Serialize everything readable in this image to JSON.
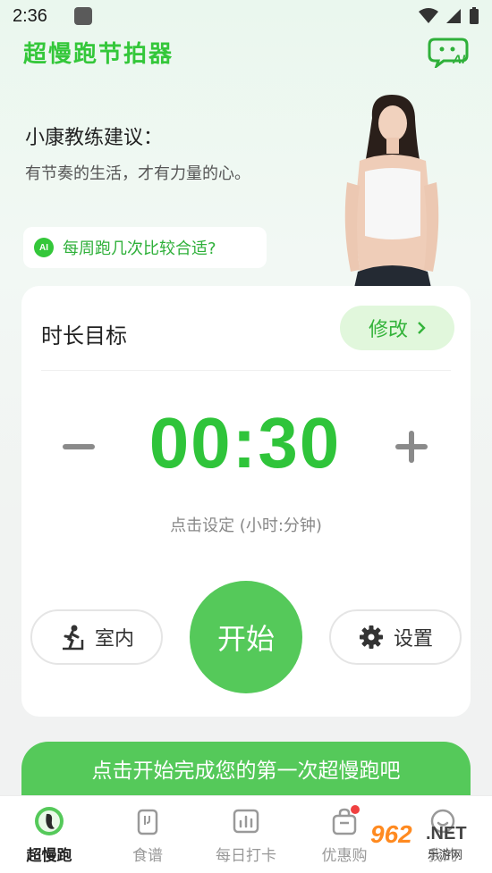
{
  "status_bar": {
    "time": "2:36"
  },
  "header": {
    "app_title": "超慢跑节拍器",
    "ai_button_label": "AI"
  },
  "coach": {
    "name": "小康教练建议：",
    "quote": "有节奏的生活，才有力量的心。",
    "suggestion_chip": "每周跑几次比较合适?",
    "chip_icon_label": "AI"
  },
  "timer_card": {
    "title": "时长目标",
    "edit_label": "修改",
    "time": "00:30",
    "hint": "点击设定 (小时:分钟)",
    "indoor_label": "室内",
    "start_label": "开始",
    "settings_label": "设置"
  },
  "cta": {
    "label": "点击开始完成您的第一次超慢跑吧"
  },
  "bottom_nav": {
    "items": [
      {
        "label": "超慢跑",
        "icon": "run-foot-icon",
        "active": true
      },
      {
        "label": "食谱",
        "icon": "recipe-icon",
        "active": false
      },
      {
        "label": "每日打卡",
        "icon": "chart-checkin-icon",
        "active": false
      },
      {
        "label": "优惠购",
        "icon": "shopping-bag-icon",
        "active": false,
        "badge": true
      },
      {
        "label": "我的",
        "icon": "smile-icon",
        "active": false
      }
    ]
  },
  "watermark": {
    "number": "962",
    "domain": ".NET",
    "site_name": "乐游网"
  },
  "colors": {
    "accent": "#34c73a",
    "button_green": "#55c95a",
    "chip_bg": "#e1f7dc",
    "badge_red": "#f04040"
  }
}
